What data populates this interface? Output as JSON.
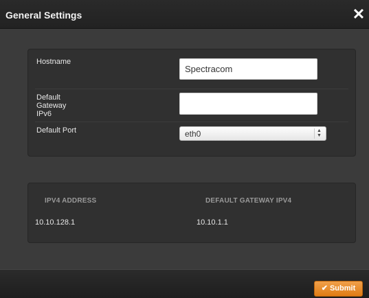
{
  "dialog": {
    "title": "General Settings",
    "close_glyph": "✕"
  },
  "settings": {
    "hostname_label": "Hostname",
    "hostname_value": "Spectracom",
    "gateway_ipv6_label": "Default\nGateway\nIPv6",
    "gateway_ipv6_value": "",
    "default_port_label": "Default Port",
    "default_port_value": "eth0"
  },
  "table": {
    "headers": [
      "IPV4 ADDRESS",
      "DEFAULT GATEWAY IPV4"
    ],
    "rows": [
      [
        "10.10.128.1",
        "10.10.1.1"
      ]
    ]
  },
  "footer": {
    "submit_label": "Submit",
    "submit_icon": "checkmark-icon",
    "accent_color": "#e8891f"
  }
}
